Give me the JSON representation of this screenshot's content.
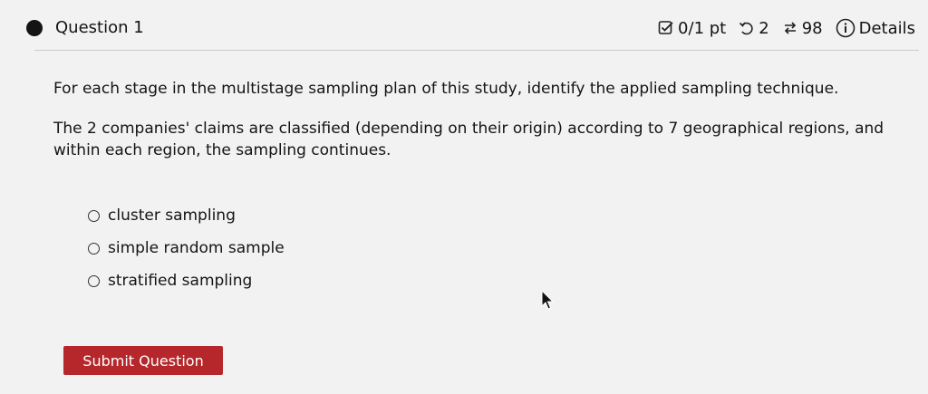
{
  "header": {
    "title": "Question 1",
    "score": "0/1 pt",
    "retries": "2",
    "attempts": "98",
    "details_label": "Details",
    "icons": [
      "score-check-icon",
      "retry-icon",
      "attempts-icon",
      "info-icon"
    ]
  },
  "question": {
    "prompt": "For each stage in the multistage sampling plan of this study, identify the applied sampling technique.",
    "context": "The 2 companies' claims are classified (depending on their origin) according to 7 geographical regions, and within each region, the sampling continues.",
    "options": [
      {
        "label": "cluster sampling",
        "selected": false
      },
      {
        "label": "simple random sample",
        "selected": false
      },
      {
        "label": "stratified sampling",
        "selected": false
      }
    ]
  },
  "actions": {
    "submit_label": "Submit Question",
    "submit_color": "#b5272a"
  }
}
